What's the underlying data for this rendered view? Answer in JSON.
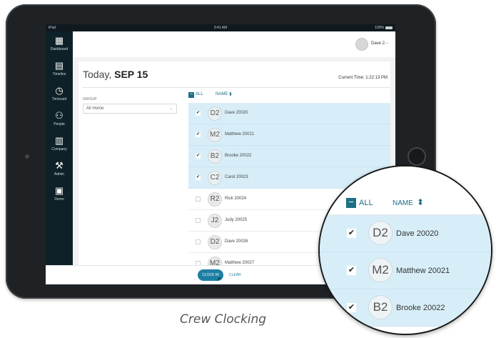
{
  "status_bar": {
    "device": "iPad",
    "time": "9:41 AM",
    "battery": "100%"
  },
  "sidebar": {
    "items": [
      {
        "label": "Dashboard",
        "icon": "dashboard-icon",
        "glyph": "▦"
      },
      {
        "label": "Timeline",
        "icon": "calendar-icon",
        "glyph": "▤"
      },
      {
        "label": "Timecard",
        "icon": "clock-icon",
        "glyph": "◷"
      },
      {
        "label": "People",
        "icon": "people-icon",
        "glyph": "⚇"
      },
      {
        "label": "Company",
        "icon": "building-icon",
        "glyph": "▥"
      },
      {
        "label": "Admin",
        "icon": "wrench-icon",
        "glyph": "⚒"
      },
      {
        "label": "Demo",
        "icon": "briefcase-icon",
        "glyph": "▣"
      }
    ]
  },
  "header": {
    "user_name": "Dave 2.",
    "user_menu_chevron": "⌄"
  },
  "page": {
    "title_prefix": "Today, ",
    "title_date": "SEP 15",
    "current_time": "Current Time: 1:22:13 PM"
  },
  "filters": {
    "group_label": "GROUP",
    "group_value": "All Home",
    "group_arrow": "⌄"
  },
  "table": {
    "select_all_label": "ALL",
    "select_all_glyph": "−",
    "name_column": "NAME",
    "sort_glyph": "⬍",
    "check_glyph": "✔",
    "rows": [
      {
        "initials": "D2",
        "name": "Dave 20020",
        "selected": true
      },
      {
        "initials": "M2",
        "name": "Matthew 20021",
        "selected": true
      },
      {
        "initials": "B2",
        "name": "Brooke 20022",
        "selected": true
      },
      {
        "initials": "C2",
        "name": "Carol 20023",
        "selected": true
      },
      {
        "initials": "R2",
        "name": "Rick 20024",
        "selected": false
      },
      {
        "initials": "J2",
        "name": "Judy 20025",
        "selected": false
      },
      {
        "initials": "D2",
        "name": "Dave 20026",
        "selected": false
      },
      {
        "initials": "M2",
        "name": "Matthew 20027",
        "selected": false
      }
    ]
  },
  "footer": {
    "clock_in_label": "CLOCK IN",
    "clear_label": "CLEAR"
  },
  "zoom": {
    "select_all_label": "ALL",
    "name_column": "NAME",
    "rows": [
      {
        "initials": "D2",
        "name": "Dave 20020"
      },
      {
        "initials": "M2",
        "name": "Matthew 20021"
      },
      {
        "initials": "B2",
        "name": "Brooke 20022"
      }
    ]
  },
  "caption": "Crew Clocking",
  "colors": {
    "accent": "#1d6f86",
    "selected_row": "#d7eef8",
    "sidebar": "#0e2128",
    "button": "#1d7fa5"
  }
}
